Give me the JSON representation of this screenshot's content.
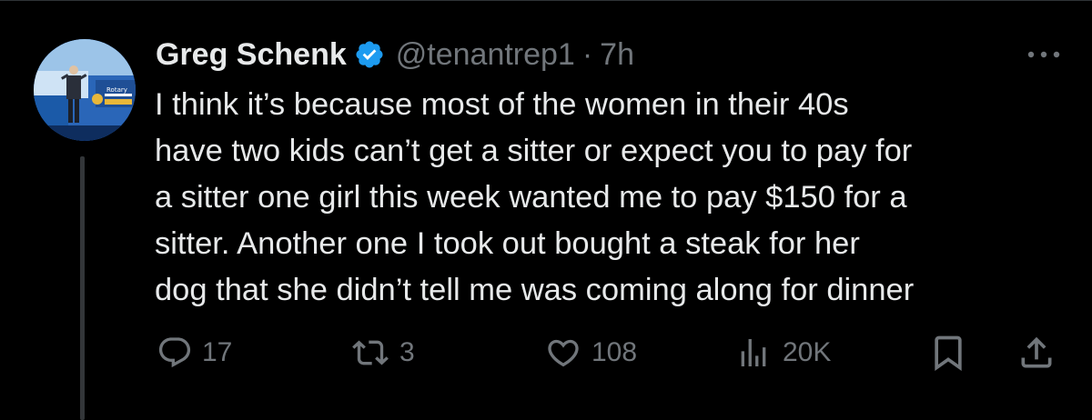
{
  "tweet": {
    "author_name": "Greg Schenk",
    "handle": "@tenantrep1",
    "separator": "·",
    "time": "7h",
    "text_lines": [
      "I think it’s because most of the women in their 40s",
      "have two kids can’t get a sitter or expect you to pay for",
      "a sitter one girl this week wanted me to pay $150 for a",
      "sitter. Another one I took out bought a steak for her",
      "dog that she didn’t tell me was coming along for dinner"
    ],
    "avatar_sign_text": "Rotary"
  },
  "actions": {
    "reply_count": "17",
    "repost_count": "3",
    "like_count": "108",
    "views_count": "20K"
  },
  "icons": {
    "verified": "verified-badge-icon",
    "more": "more-dots-icon",
    "reply": "reply-bubble-icon",
    "repost": "repost-arrows-icon",
    "like": "heart-icon",
    "views": "bar-chart-icon",
    "bookmark": "bookmark-icon",
    "share": "share-upload-icon"
  },
  "colors": {
    "background": "#000000",
    "text_primary": "#e7e9ea",
    "text_secondary": "#71767b",
    "verified_blue": "#1d9bf0",
    "thread_line": "#333639"
  }
}
